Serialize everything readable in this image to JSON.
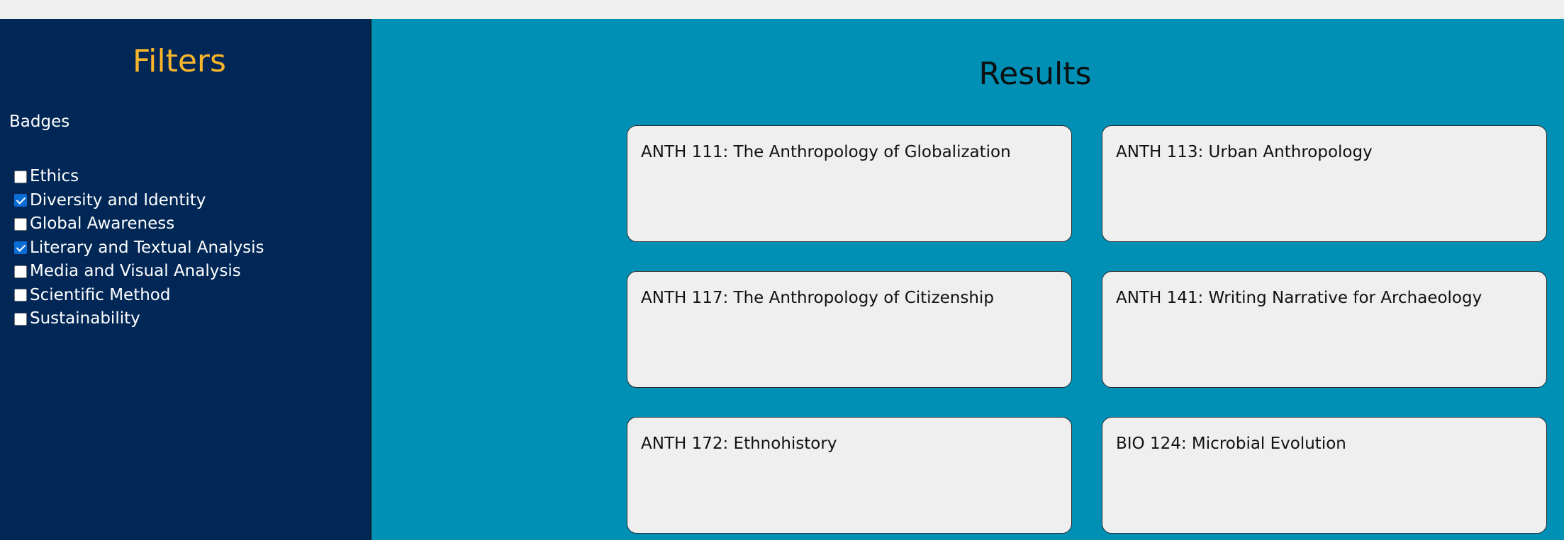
{
  "sidebar": {
    "title": "Filters",
    "section_label": "Badges",
    "filters": [
      {
        "label": "Ethics",
        "checked": false
      },
      {
        "label": "Diversity and Identity",
        "checked": true
      },
      {
        "label": "Global Awareness",
        "checked": false
      },
      {
        "label": "Literary and Textual Analysis",
        "checked": true
      },
      {
        "label": "Media and Visual Analysis",
        "checked": false
      },
      {
        "label": "Scientific Method",
        "checked": false
      },
      {
        "label": "Sustainability",
        "checked": false
      }
    ]
  },
  "main": {
    "title": "Results",
    "results": [
      {
        "title": "ANTH 111: The Anthropology of Globalization"
      },
      {
        "title": "ANTH 113: Urban Anthropology"
      },
      {
        "title": "ANTH 117: The Anthropology of Citizenship"
      },
      {
        "title": "ANTH 141: Writing Narrative for Archaeology"
      },
      {
        "title": "ANTH 172: Ethnohistory"
      },
      {
        "title": "BIO 124: Microbial Evolution"
      }
    ]
  },
  "colors": {
    "sidebar_bg": "#012756",
    "main_bg": "#0090b5",
    "accent": "#f9b52b",
    "card_bg": "#efefef",
    "checkbox_checked": "#0b6cd6"
  }
}
